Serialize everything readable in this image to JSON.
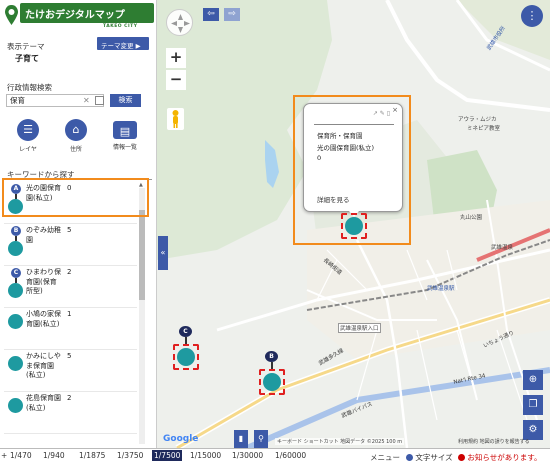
{
  "app": {
    "title": "たけおデジタルマップ",
    "subtitle": "TAKEO CITY"
  },
  "theme": {
    "label": "表示テーマ",
    "value": "子育て",
    "change_button": "テーマ変更 ▶"
  },
  "search": {
    "label": "行政情報検索",
    "value": "保育",
    "button": "検索"
  },
  "tools": [
    {
      "label": "レイヤ",
      "icon": "list-icon"
    },
    {
      "label": "住所",
      "icon": "home-icon"
    },
    {
      "label": "情報一覧",
      "icon": "table-icon"
    }
  ],
  "keyword": {
    "label": "キーワードから探す"
  },
  "results": [
    {
      "badge": "A",
      "name": "光の園保育園(私立)",
      "count": "0"
    },
    {
      "badge": "B",
      "name": "のぞみ幼稚園",
      "count": "5"
    },
    {
      "badge": "C",
      "name": "ひまわり保育園(保育所型)",
      "count": "2"
    },
    {
      "badge": "",
      "name": "小鳩の家保育園(私立)",
      "count": "1"
    },
    {
      "badge": "",
      "name": "かみにしやま保育園(私立)",
      "count": "5"
    },
    {
      "badge": "",
      "name": "花島保育園(私立)",
      "count": "2"
    }
  ],
  "popup": {
    "category": "保育所・保育園",
    "name": "光の園保育園(私立)",
    "count": "0",
    "link": "詳細を見る",
    "close": "×"
  },
  "map": {
    "places": [
      {
        "text": "武雄市役所",
        "style": "blue"
      },
      {
        "text": "アウラ・ムジカ",
        "style": ""
      },
      {
        "text": "ミネピア教室",
        "style": ""
      },
      {
        "text": "丸山公園",
        "style": ""
      },
      {
        "text": "武雄温泉",
        "style": ""
      },
      {
        "text": "武雄温泉駅",
        "style": "blue"
      },
      {
        "text": "武雄温泉駅入口",
        "style": ""
      },
      {
        "text": "いちょう通り",
        "style": ""
      },
      {
        "text": "武雄多久線",
        "style": ""
      },
      {
        "text": "武雄バイパス",
        "style": ""
      },
      {
        "text": "Nat'l Rte 34",
        "style": ""
      },
      {
        "text": "長崎街道",
        "style": ""
      }
    ],
    "markers": [
      {
        "badge": "C"
      },
      {
        "badge": "B"
      }
    ],
    "attribution": "キーボード ショートカット  地図データ ©2025  100 m",
    "terms": "利用規約  地図の誤りを報告する",
    "google": "Google",
    "colors": {
      "accent": "#3d5aa8",
      "highlight": "#f28b1c",
      "marker": "#1e9aa0"
    }
  },
  "scales": [
    "1/470",
    "1/940",
    "1/1875",
    "1/3750",
    "1/7500",
    "1/15000",
    "1/30000",
    "1/60000"
  ],
  "active_scale": "1/7500",
  "bottom": {
    "menu": "メニュー",
    "font_size": "文字サイズ",
    "notice": "お知らせがあります。"
  }
}
